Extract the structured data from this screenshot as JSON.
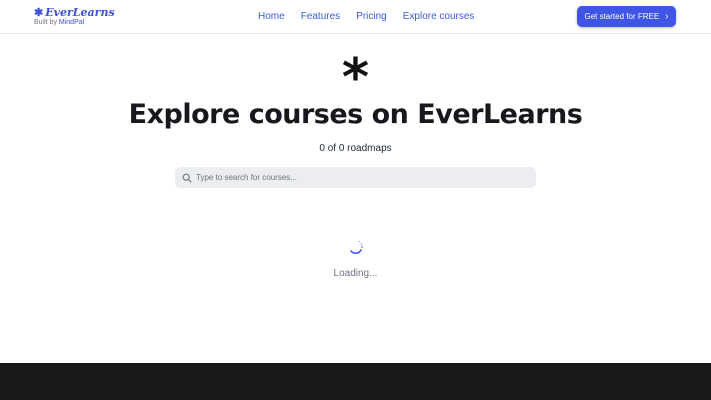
{
  "header": {
    "logo_text": "EverLearns",
    "logo_icon": "asterisk-icon",
    "built_by_prefix": "Built by ",
    "built_by_brand": "MindPal",
    "nav": [
      "Home",
      "Features",
      "Pricing",
      "Explore courses"
    ],
    "cta_label": "Get started for FREE",
    "cta_icon": "chevron-right-icon"
  },
  "hero": {
    "symbol": "*",
    "title": "Explore courses on EverLearns",
    "count_text": "0 of 0 roadmaps"
  },
  "search": {
    "placeholder": "Type to search for courses...",
    "value": "",
    "icon": "search-icon"
  },
  "status": {
    "loading_text": "Loading..."
  },
  "colors": {
    "accent": "#3f55e6",
    "nav_link": "#3b5bdb",
    "search_bg": "#ecedf1",
    "footer_bg": "#18181b"
  }
}
